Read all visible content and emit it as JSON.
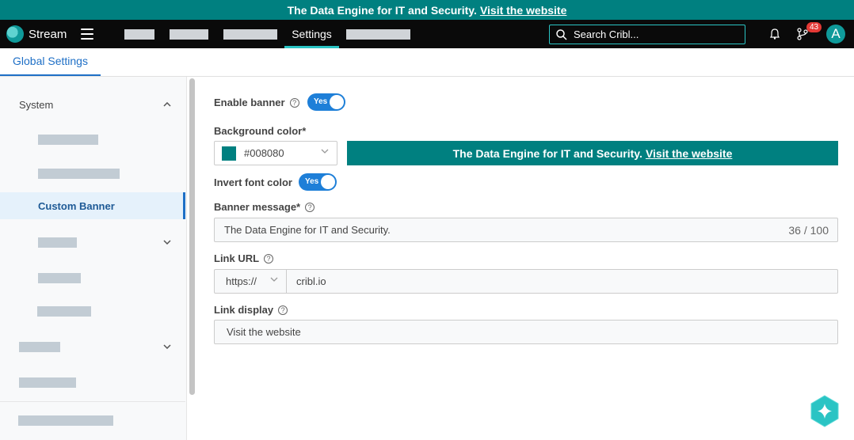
{
  "banner": {
    "message": "The Data Engine for IT and Security.",
    "link": "Visit the website"
  },
  "header": {
    "app_name": "Stream",
    "active_tab": "Settings",
    "search_placeholder": "Search Cribl...",
    "notification_count": "43",
    "avatar_letter": "A"
  },
  "tabs": {
    "global_settings": "Global Settings"
  },
  "sidebar": {
    "system": "System",
    "custom_banner": "Custom Banner"
  },
  "form": {
    "enable_banner": {
      "label": "Enable banner",
      "value": "Yes"
    },
    "background_color": {
      "label": "Background color*",
      "value": "#008080"
    },
    "invert_font": {
      "label": "Invert font color",
      "value": "Yes"
    },
    "banner_message": {
      "label": "Banner message*",
      "value": "The Data Engine for IT and Security.",
      "counter": "36 / 100"
    },
    "link_url": {
      "label": "Link URL",
      "protocol": "https://",
      "value": "cribl.io"
    },
    "link_display": {
      "label": "Link display",
      "value": "Visit the website"
    }
  },
  "colors": {
    "banner": "#008080",
    "accent": "#1e6fc6",
    "nav_bg": "#0a0a0a"
  }
}
